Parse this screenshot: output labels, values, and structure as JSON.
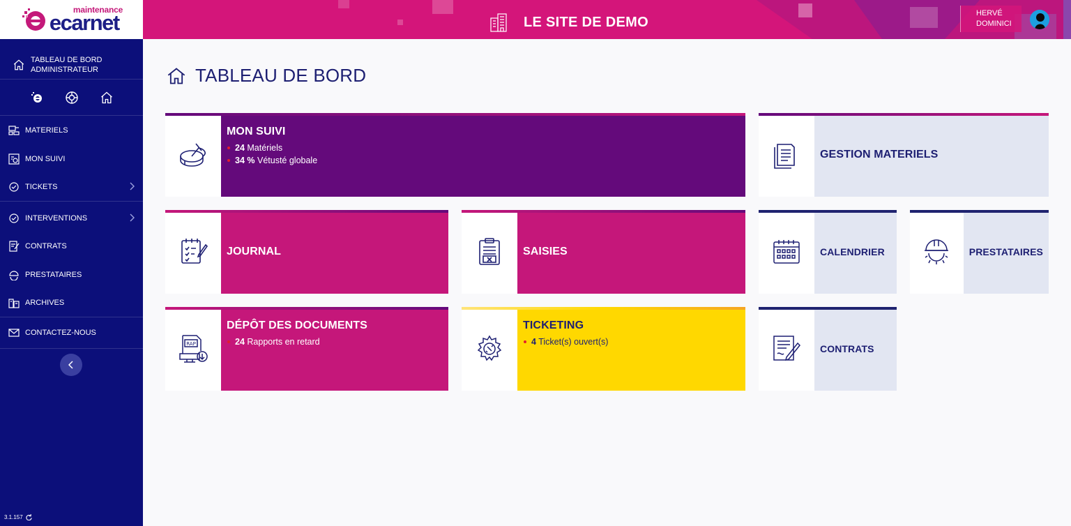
{
  "logo": {
    "top": "maintenance",
    "main": "ecarnet"
  },
  "header": {
    "site_title": "LE SITE DE DEMO",
    "user_first": "HERVÉ",
    "user_last": "DOMINICI"
  },
  "sidebar": {
    "home_label_1": "TABLEAU DE BORD",
    "home_label_2": "ADMINISTRATEUR",
    "items": [
      {
        "label": "MATERIELS"
      },
      {
        "label": "MON SUIVI"
      },
      {
        "label": "TICKETS"
      },
      {
        "label": "INTERVENTIONS"
      },
      {
        "label": "CONTRATS"
      },
      {
        "label": "PRESTATAIRES"
      },
      {
        "label": "ARCHIVES"
      },
      {
        "label": "CONTACTEZ-NOUS"
      }
    ],
    "version": "3.1.157"
  },
  "page": {
    "title": "TABLEAU DE BORD"
  },
  "cards": {
    "mon_suivi": {
      "title": "MON SUIVI",
      "line1_num": "24",
      "line1_txt": "Matériels",
      "line2_num": "34 %",
      "line2_txt": "Vétusté globale"
    },
    "gestion": {
      "title": "GESTION MATERIELS"
    },
    "journal": {
      "title": "JOURNAL"
    },
    "saisies": {
      "title": "SAISIES"
    },
    "calendrier": {
      "title": "CALENDRIER"
    },
    "prestataires": {
      "title": "PRESTATAIRES"
    },
    "depot": {
      "title": "DÉPÔT DES DOCUMENTS",
      "line1_num": "24",
      "line1_txt": "Rapports en retard",
      "icon_text": "RAP"
    },
    "ticketing": {
      "title": "TICKETING",
      "line1_num": "4",
      "line1_txt": "Ticket(s) ouvert(s)"
    },
    "contrats": {
      "title": "CONTRATS"
    }
  },
  "colors": {
    "sidebar": "#0c0f7a",
    "header": "#d4157a",
    "magenta": "#c5177a",
    "purple": "#640a7b",
    "yellow": "#ffd800",
    "light": "#e2e6f2",
    "navy": "#1d1f72"
  }
}
